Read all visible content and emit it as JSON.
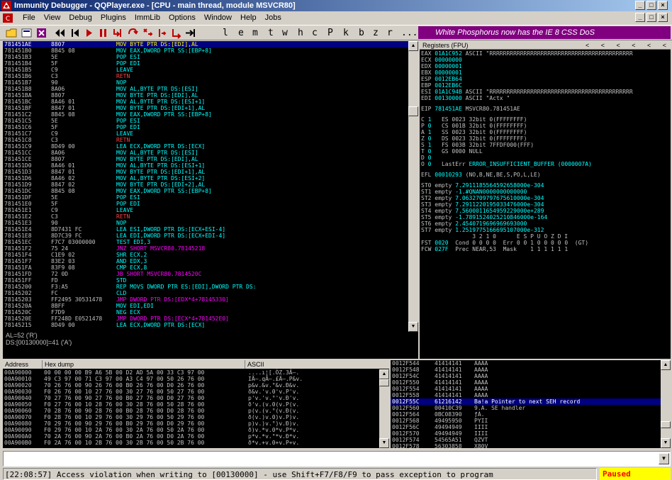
{
  "window": {
    "title": "Immunity Debugger - QQPlayer.exe - [CPU - main thread, module MSVCR80]",
    "controls": [
      "_",
      "□",
      "×"
    ]
  },
  "mdi_controls": [
    "_",
    "□",
    "×"
  ],
  "menu": [
    "File",
    "View",
    "Debug",
    "Plugins",
    "ImmLib",
    "Options",
    "Window",
    "Help",
    "Jobs"
  ],
  "toolbar": {
    "letters": [
      "l",
      "e",
      "m",
      "t",
      "w",
      "h",
      "c",
      "P",
      "k",
      "b",
      "z",
      "r",
      "...",
      "s",
      "?"
    ],
    "banner": "White Phosphorus now has the IE 8 CSS DoS"
  },
  "colors": {
    "cpu_selected": "#000080",
    "jump": "#ff00ff",
    "ret": "#ff4040",
    "normal": "#00ffff",
    "paused_bg": "#ffff00",
    "paused_fg": "#ff0000",
    "banner_bg": "#800080"
  },
  "cpu": {
    "rows": [
      {
        "addr": "781451AE",
        "hex": "8807",
        "dis": "MOV BYTE PTR DS:[EDI],AL",
        "kind": "normal",
        "selected": true
      },
      {
        "addr": "781451B0",
        "hex": "8B45 08",
        "dis": "MOV EAX,DWORD PTR SS:[EBP+8]",
        "kind": "normal"
      },
      {
        "addr": "781451B3",
        "hex": "5E",
        "dis": "POP ESI",
        "kind": "normal"
      },
      {
        "addr": "781451B4",
        "hex": "5F",
        "dis": "POP EDI",
        "kind": "normal"
      },
      {
        "addr": "781451B5",
        "hex": "C9",
        "dis": "LEAVE",
        "kind": "normal"
      },
      {
        "addr": "781451B6",
        "hex": "C3",
        "dis": "RETN",
        "kind": "ret"
      },
      {
        "addr": "781451B7",
        "hex": "90",
        "dis": "NOP",
        "kind": "normal"
      },
      {
        "addr": "781451B8",
        "hex": "8A06",
        "dis": "MOV AL,BYTE PTR DS:[ESI]",
        "kind": "normal"
      },
      {
        "addr": "781451BA",
        "hex": "8807",
        "dis": "MOV BYTE PTR DS:[EDI],AL",
        "kind": "normal"
      },
      {
        "addr": "781451BC",
        "hex": "8A46 01",
        "dis": "MOV AL,BYTE PTR DS:[ESI+1]",
        "kind": "normal"
      },
      {
        "addr": "781451BF",
        "hex": "8847 01",
        "dis": "MOV BYTE PTR DS:[EDI+1],AL",
        "kind": "normal"
      },
      {
        "addr": "781451C2",
        "hex": "8B45 08",
        "dis": "MOV EAX,DWORD PTR SS:[EBP+8]",
        "kind": "normal"
      },
      {
        "addr": "781451C5",
        "hex": "5E",
        "dis": "POP ESI",
        "kind": "normal"
      },
      {
        "addr": "781451C6",
        "hex": "5F",
        "dis": "POP EDI",
        "kind": "normal"
      },
      {
        "addr": "781451C7",
        "hex": "C9",
        "dis": "LEAVE",
        "kind": "normal"
      },
      {
        "addr": "781451C8",
        "hex": "C3",
        "dis": "RETN",
        "kind": "ret"
      },
      {
        "addr": "781451C9",
        "hex": "8D49 00",
        "dis": "LEA ECX,DWORD PTR DS:[ECX]",
        "kind": "normal"
      },
      {
        "addr": "781451CC",
        "hex": "8A06",
        "dis": "MOV AL,BYTE PTR DS:[ESI]",
        "kind": "normal"
      },
      {
        "addr": "781451CE",
        "hex": "8807",
        "dis": "MOV BYTE PTR DS:[EDI],AL",
        "kind": "normal"
      },
      {
        "addr": "781451D0",
        "hex": "8A46 01",
        "dis": "MOV AL,BYTE PTR DS:[ESI+1]",
        "kind": "normal"
      },
      {
        "addr": "781451D3",
        "hex": "8847 01",
        "dis": "MOV BYTE PTR DS:[EDI+1],AL",
        "kind": "normal"
      },
      {
        "addr": "781451D6",
        "hex": "8A46 02",
        "dis": "MOV AL,BYTE PTR DS:[ESI+2]",
        "kind": "normal"
      },
      {
        "addr": "781451D9",
        "hex": "8847 02",
        "dis": "MOV BYTE PTR DS:[EDI+2],AL",
        "kind": "normal"
      },
      {
        "addr": "781451DC",
        "hex": "8B45 08",
        "dis": "MOV EAX,DWORD PTR SS:[EBP+8]",
        "kind": "normal"
      },
      {
        "addr": "781451DF",
        "hex": "5E",
        "dis": "POP ESI",
        "kind": "normal"
      },
      {
        "addr": "781451E0",
        "hex": "5F",
        "dis": "POP EDI",
        "kind": "normal"
      },
      {
        "addr": "781451E1",
        "hex": "C9",
        "dis": "LEAVE",
        "kind": "normal"
      },
      {
        "addr": "781451E2",
        "hex": "C3",
        "dis": "RETN",
        "kind": "ret"
      },
      {
        "addr": "781451E3",
        "hex": "90",
        "dis": "NOP",
        "kind": "normal"
      },
      {
        "addr": "781451E4",
        "hex": "8D7431 FC",
        "dis": "LEA ESI,DWORD PTR DS:[ECX+ESI-4]",
        "kind": "normal"
      },
      {
        "addr": "781451E8",
        "hex": "8D7C39 FC",
        "dis": "LEA EDI,DWORD PTR DS:[ECX+EDI-4]",
        "kind": "normal"
      },
      {
        "addr": "781451EC",
        "hex": "F7C7 03000000",
        "dis": "TEST EDI,3",
        "kind": "normal"
      },
      {
        "addr": "781451F2",
        "hex": "75 24",
        "dis": "JNZ SHORT MSVCR80.78145218",
        "kind": "jump"
      },
      {
        "addr": "781451F4",
        "hex": "C1E9 02",
        "dis": "SHR ECX,2",
        "kind": "normal"
      },
      {
        "addr": "781451F7",
        "hex": "83E2 03",
        "dis": "AND EDX,3",
        "kind": "normal"
      },
      {
        "addr": "781451FA",
        "hex": "83F9 08",
        "dis": "CMP ECX,8",
        "kind": "normal"
      },
      {
        "addr": "781451FD",
        "hex": "72 0D",
        "dis": "JB SHORT MSVCR80.7814520C",
        "kind": "jump"
      },
      {
        "addr": "781451FF",
        "hex": "FD",
        "dis": "STD",
        "kind": "normal"
      },
      {
        "addr": "78145200",
        "hex": "F3:A5",
        "dis": "REP MOVS DWORD PTR ES:[EDI],DWORD PTR DS:",
        "kind": "normal"
      },
      {
        "addr": "78145202",
        "hex": "FC",
        "dis": "CLD",
        "kind": "normal"
      },
      {
        "addr": "78145203",
        "hex": "FF2495 30531478",
        "dis": "JMP DWORD PTR DS:[EDX*4+78145330]",
        "kind": "jump"
      },
      {
        "addr": "7814520A",
        "hex": "8BFF",
        "dis": "MOV EDI,EDI",
        "kind": "normal"
      },
      {
        "addr": "7814520C",
        "hex": "F7D9",
        "dis": "NEG ECX",
        "kind": "normal"
      },
      {
        "addr": "7814520E",
        "hex": "FF248D E0521478",
        "dis": "JMP DWORD PTR DS:[ECX*4+781452E0]",
        "kind": "jump"
      },
      {
        "addr": "78145215",
        "hex": "8D49 00",
        "dis": "LEA ECX,DWORD PTR DS:[ECX]",
        "kind": "normal"
      }
    ]
  },
  "info": {
    "lines": [
      "AL=52 ('R')",
      "DS:[00130000]=41 ('A')"
    ]
  },
  "registers": {
    "header": "Registers (FPU)",
    "nav": "<  <  <  <  <  <",
    "gp": [
      {
        "name": "EAX",
        "value": "01A1C952",
        "comment": "ASCII \"RRRRRRRRRRRRRRRRRRRRRRRRRRRRRRRRRRRRRRRRRR"
      },
      {
        "name": "ECX",
        "value": "00000000",
        "comment": ""
      },
      {
        "name": "EDX",
        "value": "00000001",
        "comment": ""
      },
      {
        "name": "EBX",
        "value": "00000001",
        "comment": ""
      },
      {
        "name": "ESP",
        "value": "0012EB64",
        "comment": ""
      },
      {
        "name": "EBP",
        "value": "0012EB6C",
        "comment": ""
      },
      {
        "name": "ESI",
        "value": "01A1C94B",
        "comment": "ASCII \"RRRRRRRRRRRRRRRRRRRRRRRRRRRRRRRRRRRRRRRRRR"
      },
      {
        "name": "EDI",
        "value": "00130000",
        "comment": "ASCII \"Actx \""
      }
    ],
    "eip": {
      "name": "EIP",
      "value": "781451AE",
      "comment": "MSVCR80.781451AE"
    },
    "flags": [
      {
        "f": "C",
        "v": "1",
        "seg": "ES",
        "sel": "0023",
        "bits": "32bit",
        "base": "0(FFFFFFFF)"
      },
      {
        "f": "P",
        "v": "0",
        "seg": "CS",
        "sel": "001B",
        "bits": "32bit",
        "base": "0(FFFFFFFF)"
      },
      {
        "f": "A",
        "v": "1",
        "seg": "SS",
        "sel": "0023",
        "bits": "32bit",
        "base": "0(FFFFFFFF)"
      },
      {
        "f": "Z",
        "v": "0",
        "seg": "DS",
        "sel": "0023",
        "bits": "32bit",
        "base": "0(FFFFFFFF)"
      },
      {
        "f": "S",
        "v": "1",
        "seg": "FS",
        "sel": "003B",
        "bits": "32bit",
        "base": "7FFDF000(FFF)"
      },
      {
        "f": "T",
        "v": "0",
        "seg": "GS",
        "sel": "0000",
        "bits": "NULL",
        "base": ""
      },
      {
        "f": "D",
        "v": "0",
        "seg": "",
        "sel": "",
        "bits": "",
        "base": ""
      },
      {
        "f": "O",
        "v": "0",
        "seg": "LastErr",
        "sel": "ERROR_INSUFFICIENT_BUFFER (0000007A)",
        "bits": "",
        "base": ""
      }
    ],
    "efl": {
      "name": "EFL",
      "value": "00010293",
      "comment": "(NO,B,NE,BE,S,PO,L,LE)"
    },
    "fpu": [
      {
        "name": "ST0",
        "tag": "empty",
        "val": "7.2911185564592658000e-304"
      },
      {
        "name": "ST1",
        "tag": "empty",
        "val": "-1.#QNAN0000000000000"
      },
      {
        "name": "ST2",
        "tag": "empty",
        "val": "7.0632709797675610000e-304"
      },
      {
        "name": "ST3",
        "tag": "empty",
        "val": "7.2911220195033476000e-304"
      },
      {
        "name": "ST4",
        "tag": "empty",
        "val": "7.5600011654959229000e+289"
      },
      {
        "name": "ST5",
        "tag": "empty",
        "val": "-1.7891524025210846000e-164"
      },
      {
        "name": "ST6",
        "tag": "empty",
        "val": "2.4540719696969693000"
      },
      {
        "name": "ST7",
        "tag": "empty",
        "val": "1.2519775166695107000e-312"
      }
    ],
    "fpu_bits_header": "               3 2 1 0      E S P U O Z D I",
    "fst": {
      "name": "FST",
      "value": "0020",
      "rest": "Cond 0 0 0 0  Err 0 0 1 0 0 0 0 0  (GT)"
    },
    "fcw": {
      "name": "FCW",
      "value": "027F",
      "rest": "Prec NEAR,53  Mask    1 1 1 1 1 1"
    }
  },
  "dump": {
    "headers": [
      "Address",
      "Hex dump",
      "ASCII"
    ],
    "rows": [
      {
        "addr": "00A90000",
        "hex": "00 00 00 00 B9 A6 5B 00 D2 AD 5A 00 33 C3 97 00",
        "ascii": "....ı¦[.Ò­Z.3Ã—."
      },
      {
        "addr": "00A90010",
        "hex": "49 C3 97 00 71 C3 97 00 A3 C4 97 00 50 26 76 00",
        "ascii": "IÃ—.qÃ—.£Ä—.P&v."
      },
      {
        "addr": "00A90020",
        "hex": "70 26 76 00 90 26 76 00 B0 26 76 00 D0 26 76 00",
        "ascii": "p&v.&v.°&v.Ð&v."
      },
      {
        "addr": "00A90030",
        "hex": "F0 26 76 00 10 27 76 00 30 27 76 00 50 27 76 00",
        "ascii": "ð&v.'v.0'v.P'v."
      },
      {
        "addr": "00A90040",
        "hex": "70 27 76 00 90 27 76 00 B0 27 76 00 D0 27 76 00",
        "ascii": "p'v.'v.°'v.Ð'v."
      },
      {
        "addr": "00A90050",
        "hex": "F0 27 76 00 10 28 76 00 30 28 76 00 50 28 76 00",
        "ascii": "ð'v.(v.0(v.P(v."
      },
      {
        "addr": "00A90060",
        "hex": "70 28 76 00 90 28 76 00 B0 28 76 00 D0 28 76 00",
        "ascii": "p(v.(v.°(v.Ð(v."
      },
      {
        "addr": "00A90070",
        "hex": "F0 28 76 00 10 29 76 00 30 29 76 00 50 29 76 00",
        "ascii": "ð(v.)v.0)v.P)v."
      },
      {
        "addr": "00A90080",
        "hex": "70 29 76 00 90 29 76 00 B0 29 76 00 D0 29 76 00",
        "ascii": "p)v.)v.°)v.Ð)v."
      },
      {
        "addr": "00A90090",
        "hex": "F0 29 76 00 10 2A 76 00 30 2A 76 00 50 2A 76 00",
        "ascii": "ð)v.*v.0*v.P*v."
      },
      {
        "addr": "00A900A0",
        "hex": "70 2A 76 00 90 2A 76 00 B0 2A 76 00 D0 2A 76 00",
        "ascii": "p*v.*v.°*v.Ð*v."
      },
      {
        "addr": "00A900B0",
        "hex": "F0 2A 76 00 10 2B 76 00 30 2B 76 00 50 2B 76 00",
        "ascii": "ð*v.+v.0+v.P+v."
      }
    ]
  },
  "stack": {
    "rows": [
      {
        "addr": "0012F544",
        "val": "41414141",
        "comment": "AAAA"
      },
      {
        "addr": "0012F548",
        "val": "41414141",
        "comment": "AAAA"
      },
      {
        "addr": "0012F54C",
        "val": "41414141",
        "comment": "AAAA"
      },
      {
        "addr": "0012F550",
        "val": "41414141",
        "comment": "AAAA"
      },
      {
        "addr": "0012F554",
        "val": "41414141",
        "comment": "AAAA"
      },
      {
        "addr": "0012F558",
        "val": "41414141",
        "comment": "AAAA"
      },
      {
        "addr": "0012F55C",
        "val": "61216142",
        "comment": "Ba!a Pointer to next SEH record",
        "selected": true
      },
      {
        "addr": "0012F560",
        "val": "00410C39",
        "comment": "9.A. SE handler"
      },
      {
        "addr": "0012F564",
        "val": "0BC08390",
        "comment": "ƒÀ."
      },
      {
        "addr": "0012F568",
        "val": "49495950",
        "comment": "PYII"
      },
      {
        "addr": "0012F56C",
        "val": "49494949",
        "comment": "IIII"
      },
      {
        "addr": "0012F570",
        "val": "49494949",
        "comment": "IIII"
      },
      {
        "addr": "0012F574",
        "val": "54565A51",
        "comment": "QZVT"
      },
      {
        "addr": "0012F578",
        "val": "56303858",
        "comment": "X80V"
      }
    ]
  },
  "command": {
    "value": "",
    "dropdown": "▼"
  },
  "status": {
    "message": "[22:08:57] Access violation when writing to [00130000] - use Shift+F7/F8/F9 to pass exception to program",
    "state": "Paused"
  }
}
